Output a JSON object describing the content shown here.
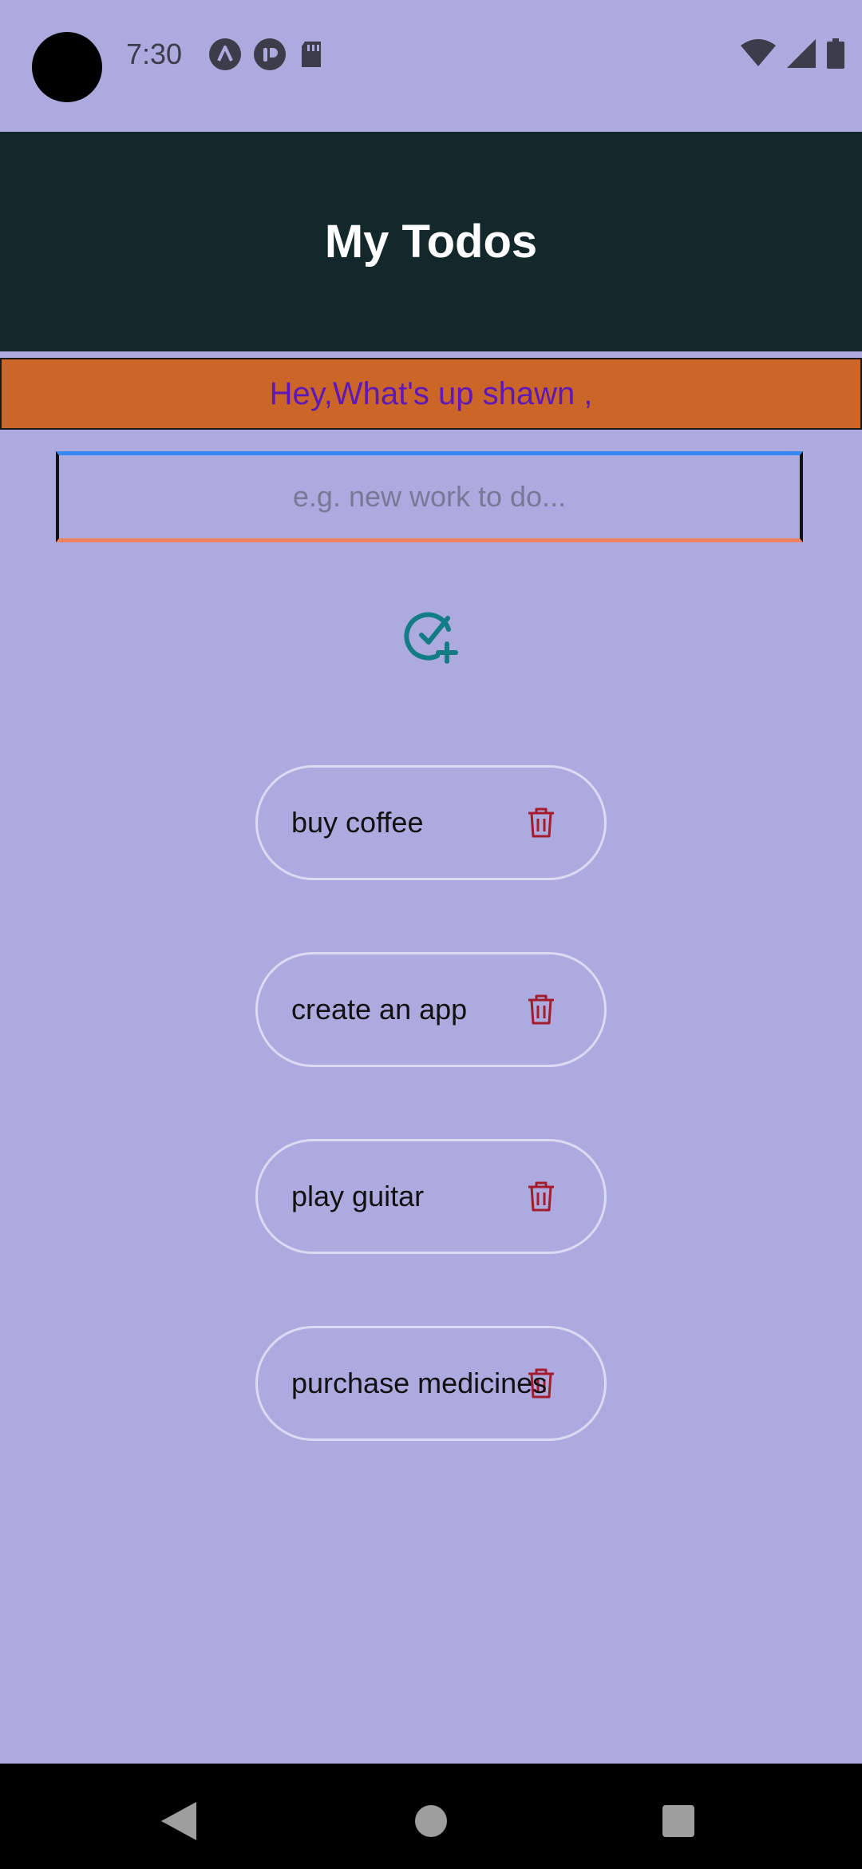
{
  "status_bar": {
    "time": "7:30",
    "left_icons": [
      "a-notification-icon",
      "p-notification-icon",
      "sd-card-icon"
    ],
    "right_icons": [
      "wifi-icon",
      "cellular-signal-icon",
      "battery-icon"
    ]
  },
  "header": {
    "title": "My Todos"
  },
  "greeting": {
    "text": "Hey,What's up shawn ,"
  },
  "input": {
    "placeholder": "e.g. new work to do...",
    "value": ""
  },
  "add_button": {
    "icon": "add-task-icon"
  },
  "todos": [
    {
      "label": "buy coffee",
      "delete_icon": "trash-icon"
    },
    {
      "label": "create an app",
      "delete_icon": "trash-icon"
    },
    {
      "label": "play guitar",
      "delete_icon": "trash-icon"
    },
    {
      "label": "purchase medicines",
      "delete_icon": "trash-icon"
    }
  ],
  "colors": {
    "background": "#adaadf",
    "header_bg": "#13282a",
    "banner_bg": "#cb6628",
    "banner_text": "#5f18b8",
    "add_icon": "#137c84",
    "delete_icon": "#a21c2c"
  },
  "nav_bar": {
    "icons": [
      "back-icon",
      "home-icon",
      "recents-icon"
    ]
  }
}
